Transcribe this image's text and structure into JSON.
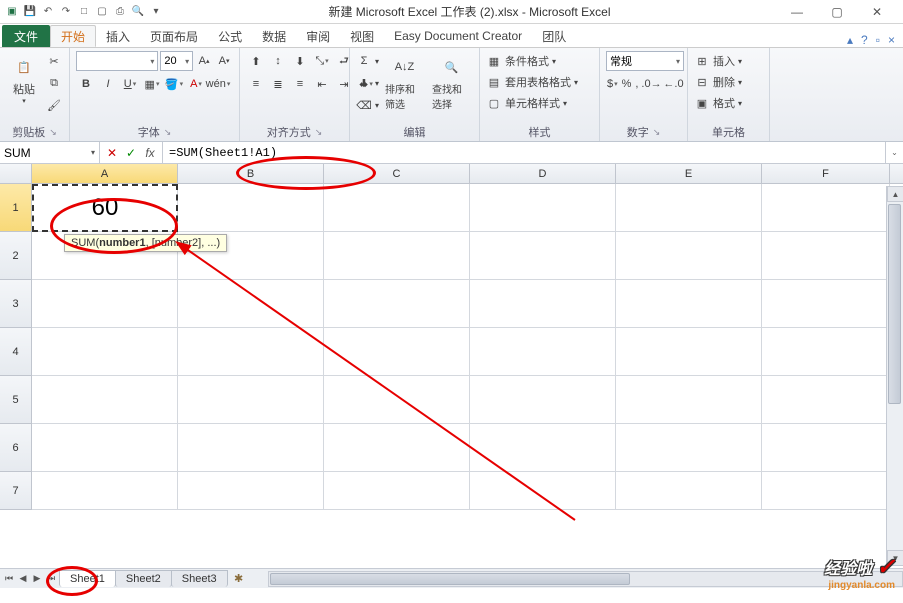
{
  "title": "新建 Microsoft Excel 工作表 (2).xlsx - Microsoft Excel",
  "tabs": {
    "file": "文件",
    "home": "开始",
    "insert": "插入",
    "layout": "页面布局",
    "formulas": "公式",
    "data": "数据",
    "review": "审阅",
    "view": "视图",
    "edc": "Easy Document Creator",
    "team": "团队"
  },
  "ribbon": {
    "clipboard": {
      "paste": "粘贴",
      "label": "剪贴板"
    },
    "font": {
      "size": "20",
      "bold": "B",
      "italic": "I",
      "underline": "U",
      "label": "字体"
    },
    "align": {
      "label": "对齐方式"
    },
    "number": {
      "normal": "常规",
      "label": "数字"
    },
    "edit": {
      "sort": "排序和筛选",
      "find": "查找和选择",
      "label": "编辑"
    },
    "styles": {
      "cond": "条件格式",
      "table": "套用表格格式",
      "cell": "单元格样式",
      "label": "样式"
    },
    "cells": {
      "insert": "插入",
      "delete": "删除",
      "format": "格式",
      "label": "单元格"
    }
  },
  "formula": {
    "namebox": "SUM",
    "value": "=SUM(Sheet1!A1)",
    "tooltip_fn": "SUM",
    "tooltip_arg1": "number1",
    "tooltip_rest": ", [number2], ...)"
  },
  "columns": [
    "A",
    "B",
    "C",
    "D",
    "E",
    "F"
  ],
  "rows": [
    "1",
    "2",
    "3",
    "4",
    "5",
    "6",
    "7"
  ],
  "cellA1": "60",
  "sheets": {
    "s1": "Sheet1",
    "s2": "Sheet2",
    "s3": "Sheet3"
  },
  "watermark": {
    "main": "经验啦",
    "sub": "jingyanla.com"
  },
  "chart_data": {
    "type": "table",
    "title": "Excel worksheet cell data",
    "columns": [
      "A"
    ],
    "rows": [
      {
        "row": 1,
        "A": 60
      }
    ],
    "formula_bar": "=SUM(Sheet1!A1)",
    "active_cell": "A1",
    "active_sheet": "Sheet1"
  }
}
